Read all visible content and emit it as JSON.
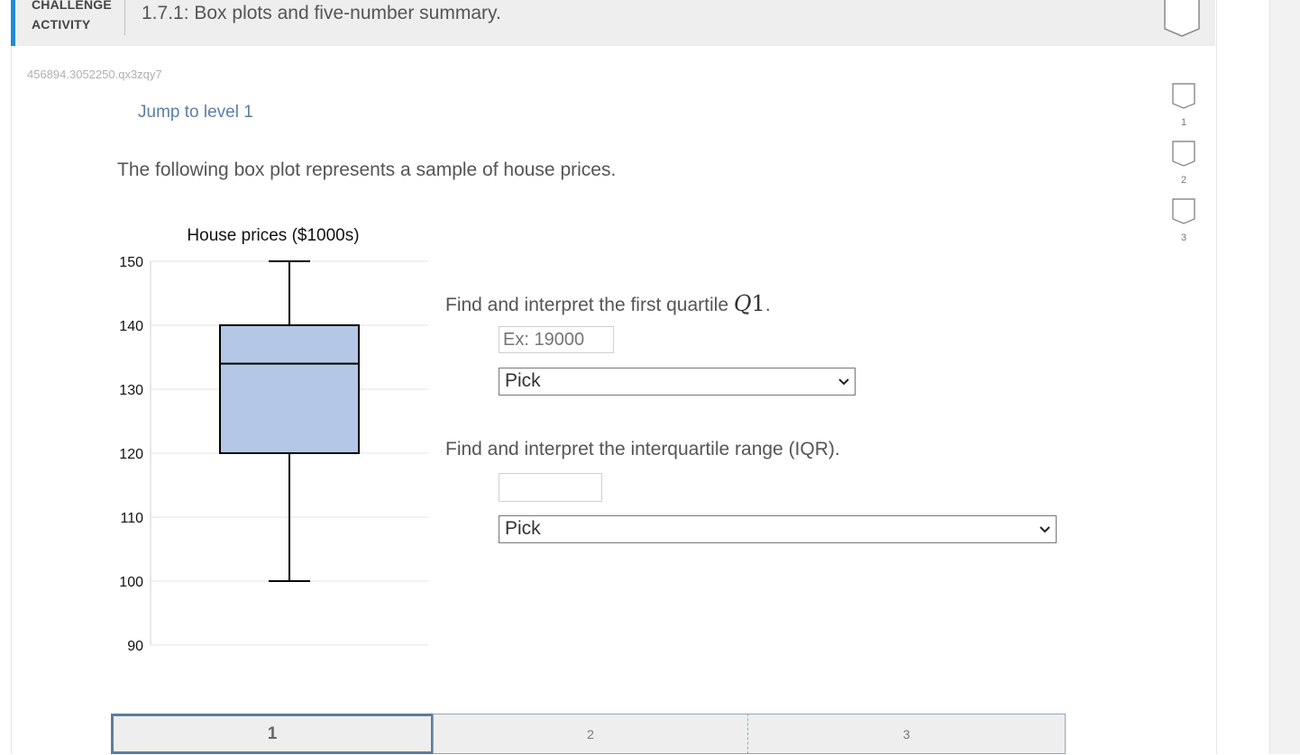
{
  "header": {
    "kind_line1": "CHALLENGE",
    "kind_line2": "ACTIVITY",
    "title": "1.7.1: Box plots and five-number summary.",
    "accent_color": "#1e8bd6"
  },
  "activity_code": "456894.3052250.qx3zqy7",
  "jump_link": "Jump to level 1",
  "prompt": "The following box plot represents a sample of house prices.",
  "chart_data": {
    "type": "boxplot",
    "title": "House prices ($1000s)",
    "ylim": [
      90,
      150
    ],
    "yticks": [
      "150",
      "140",
      "130",
      "120",
      "110",
      "100",
      "90"
    ],
    "box": {
      "min": 100,
      "q1": 120,
      "median": 134,
      "q3": 140,
      "max": 150
    },
    "box_color": "#b4c7e7",
    "grid": true
  },
  "questions": {
    "q1": {
      "text": "Find and interpret the first quartile ",
      "math_var": "Q",
      "math_num": "1",
      "tail": ".",
      "placeholder": "Ex: 19000",
      "select_value": "Pick"
    },
    "q2": {
      "text": "Find and interpret the interquartile range (IQR).",
      "placeholder": "",
      "select_value": "Pick"
    }
  },
  "level_nav": [
    "1",
    "2",
    "3"
  ],
  "progress_steps": [
    "1",
    "2",
    "3"
  ],
  "active_step": "1"
}
